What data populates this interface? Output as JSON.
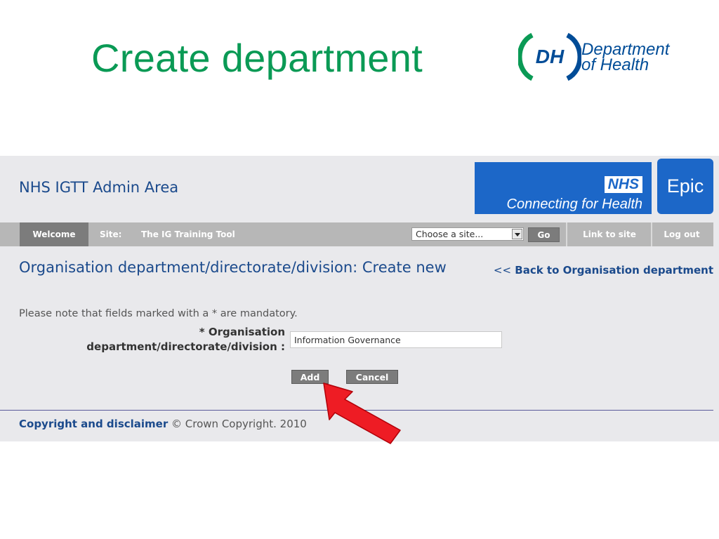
{
  "slide": {
    "title": "Create department",
    "logo": {
      "badge": "DH",
      "line1": "Department",
      "line2": "of Health"
    }
  },
  "app": {
    "title": "NHS IGTT Admin Area",
    "banner": {
      "logo": "NHS",
      "tagline": "Connecting for Health"
    },
    "epic_label": "Epic"
  },
  "navbar": {
    "welcome": "Welcome",
    "site_label": "Site:",
    "site_name": "The IG Training Tool",
    "site_select": "Choose a site...",
    "go": "Go",
    "link_to_site": "Link to site",
    "log_out": "Log out"
  },
  "main": {
    "heading": "Organisation department/directorate/division: Create new",
    "back_prefix": "<<",
    "back_link": "Back to Organisation department",
    "mandatory_note": "Please note that fields marked with a * are mandatory.",
    "field_label": "* Organisation department/directorate/division :",
    "field_value": "Information Governance",
    "add": "Add",
    "cancel": "Cancel"
  },
  "footer": {
    "link": "Copyright and disclaimer",
    "text": "© Crown Copyright. 2010"
  },
  "colors": {
    "slide_title": "#0a9a55",
    "nhs_blue": "#1c67c8",
    "link_blue": "#1b4a8c",
    "arrow_red": "#ee1c24"
  },
  "annotation": {
    "type": "red-arrow",
    "points_to": "add-button"
  }
}
